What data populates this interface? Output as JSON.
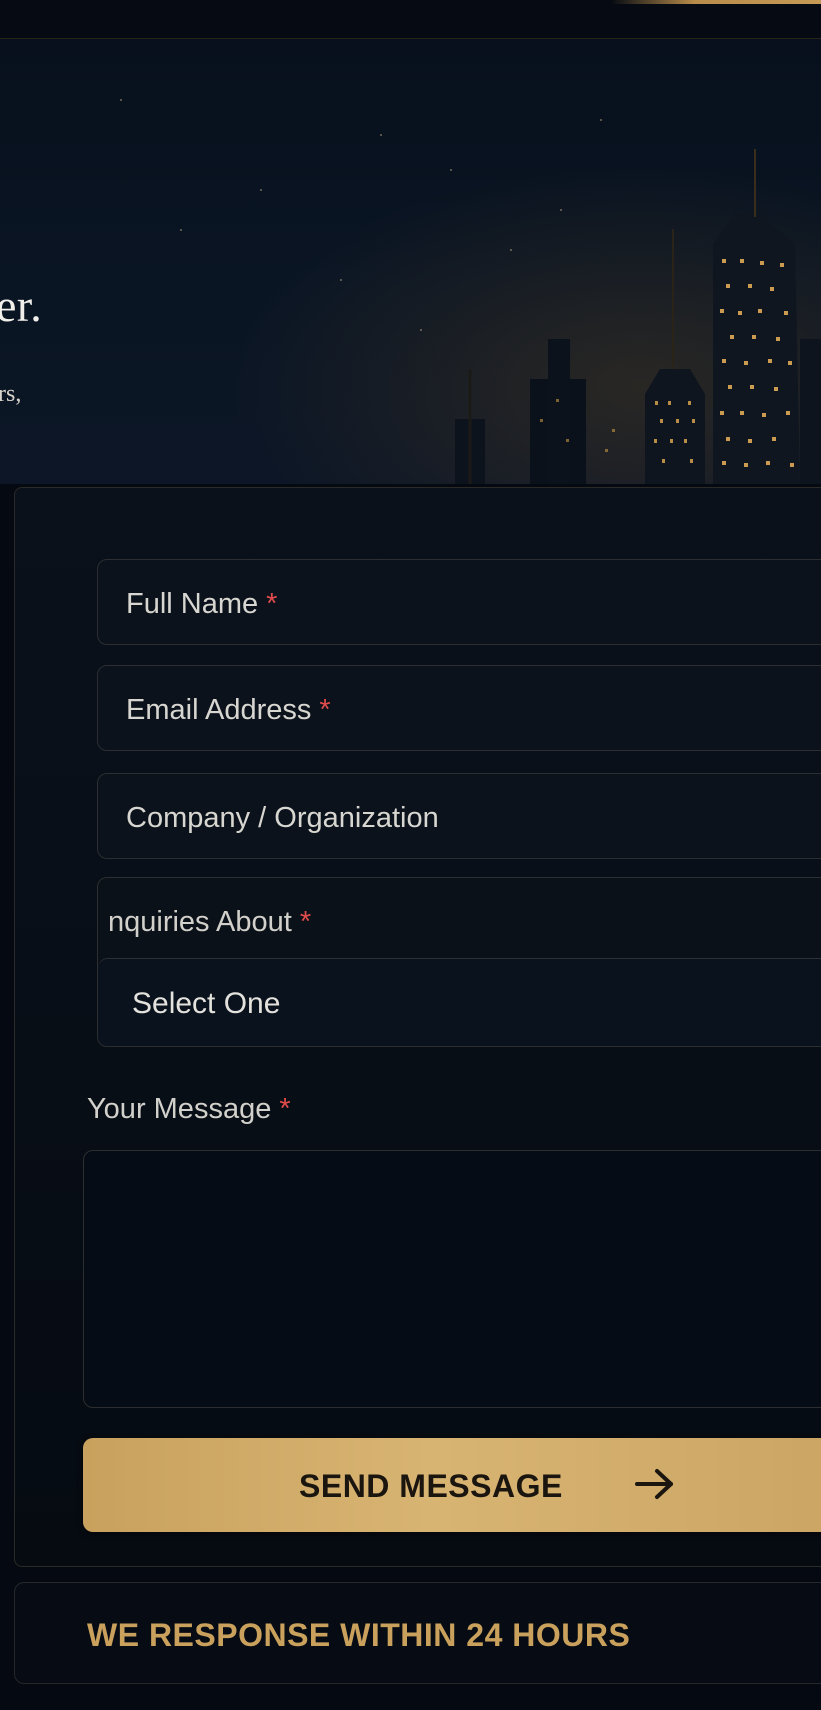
{
  "hero": {
    "title_fragment": "er.",
    "subtitle_fragment": "rs,"
  },
  "form": {
    "full_name_label": "Full Name",
    "email_label": "Email Address",
    "company_label": "Company / Organization",
    "inquiry_label": "nquiries About",
    "inquiry_selected": "Select One",
    "message_label": "Your Message",
    "message_value": "",
    "required_marker": "*",
    "submit_label": "SEND MESSAGE"
  },
  "banner": {
    "response_text": "WE RESPONSE WITHIN 24 HOURS"
  },
  "colors": {
    "accent_gold": "#c9a05c",
    "required_red": "#e14b4b",
    "background": "#050a12"
  },
  "icons": {
    "submit_icon": "arrow-right-icon"
  }
}
